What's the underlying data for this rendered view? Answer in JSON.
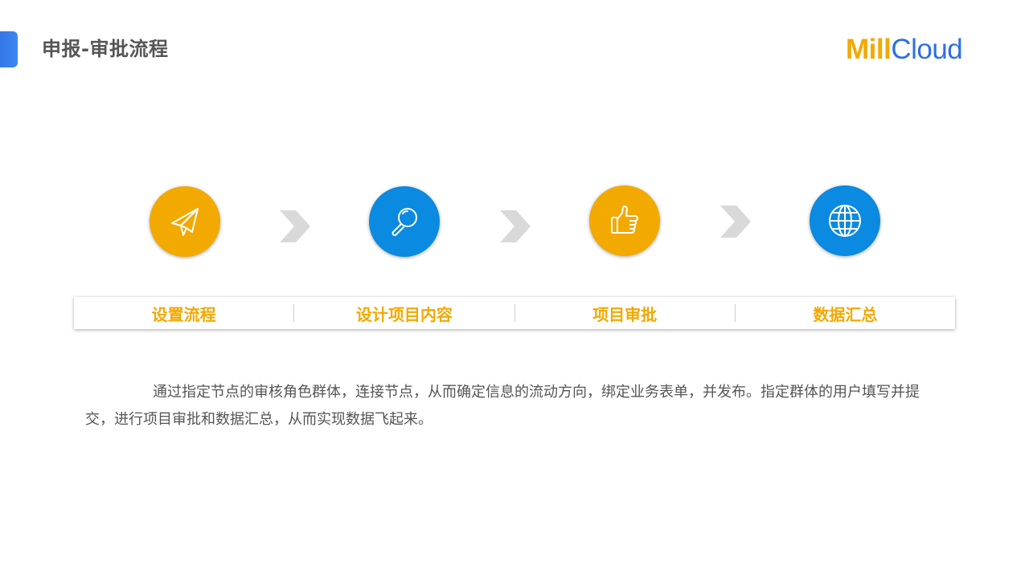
{
  "header": {
    "title": "申报-审批流程",
    "logo": {
      "part1": "Mill",
      "part2": "Cloud"
    }
  },
  "colors": {
    "accent_blue": "#2f6fe0",
    "step_orange": "#f2a900",
    "step_blue": "#0a8ae0",
    "chevron_gray": "#d9d9d9",
    "label_orange": "#f2a900",
    "text_gray": "#555555"
  },
  "steps": [
    {
      "label": "设置流程",
      "icon": "paper-plane-icon",
      "color": "orange"
    },
    {
      "label": "设计项目内容",
      "icon": "magnifier-icon",
      "color": "blue"
    },
    {
      "label": "项目审批",
      "icon": "thumbs-up-icon",
      "color": "orange"
    },
    {
      "label": "数据汇总",
      "icon": "globe-icon",
      "color": "blue"
    }
  ],
  "description": "通过指定节点的审核角色群体，连接节点，从而确定信息的流动方向，绑定业务表单，并发布。指定群体的用户填写并提交，进行项目审批和数据汇总，从而实现数据飞起来。"
}
